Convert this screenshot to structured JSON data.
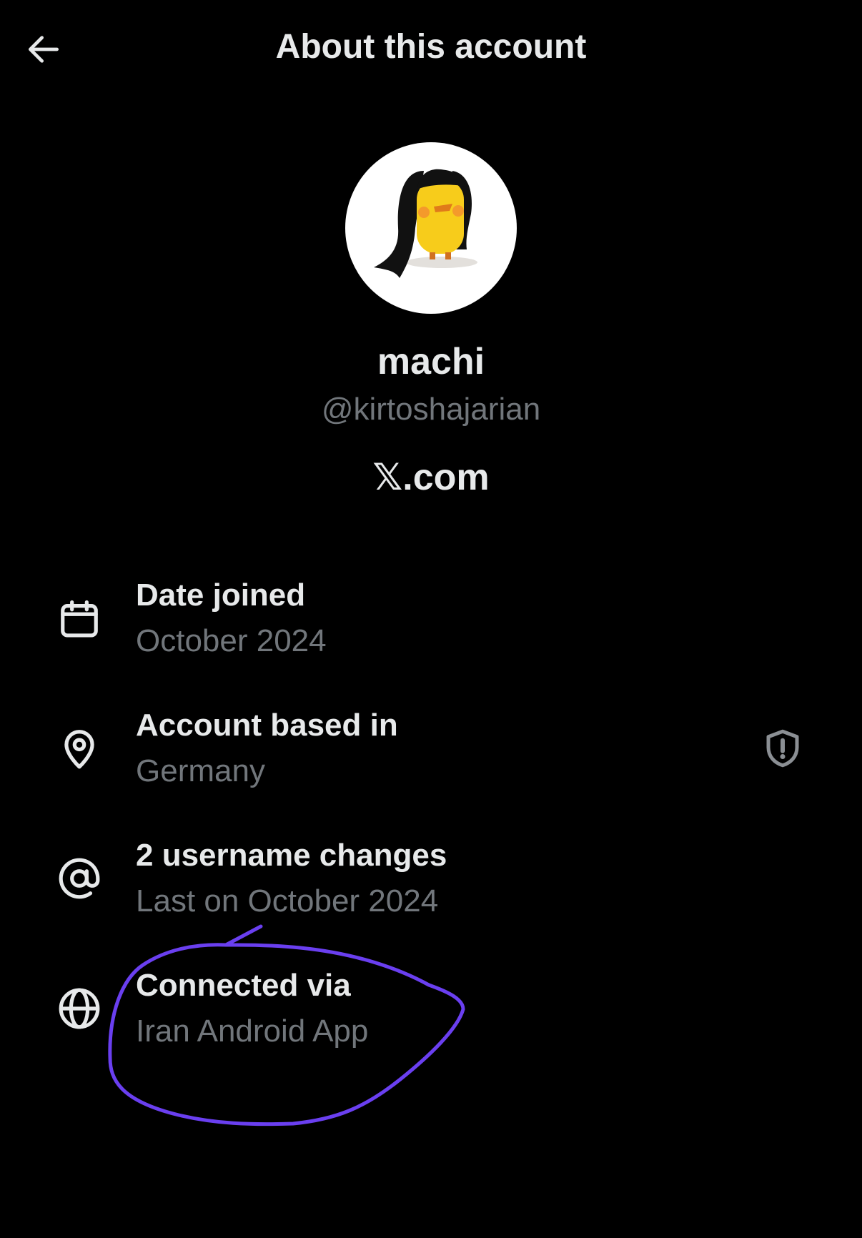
{
  "header": {
    "title": "About this account",
    "back_icon": "arrow-left-icon"
  },
  "profile": {
    "display_name": "machi",
    "handle": "@kirtoshajarian",
    "brand": "𝕏.com"
  },
  "details": [
    {
      "icon": "calendar-icon",
      "label": "Date joined",
      "value": "October 2024"
    },
    {
      "icon": "location-pin-icon",
      "label": "Account based in",
      "value": "Germany",
      "trailing_icon": "shield-alert-icon"
    },
    {
      "icon": "at-sign-icon",
      "label": "2 username changes",
      "value": "Last on October 2024"
    },
    {
      "icon": "globe-icon",
      "label": "Connected via",
      "value": "Iran Android App"
    }
  ],
  "colors": {
    "background": "#000000",
    "primary_text": "#e7e9ea",
    "secondary_text": "#71767b",
    "annotation_stroke": "#6a3ff0"
  }
}
